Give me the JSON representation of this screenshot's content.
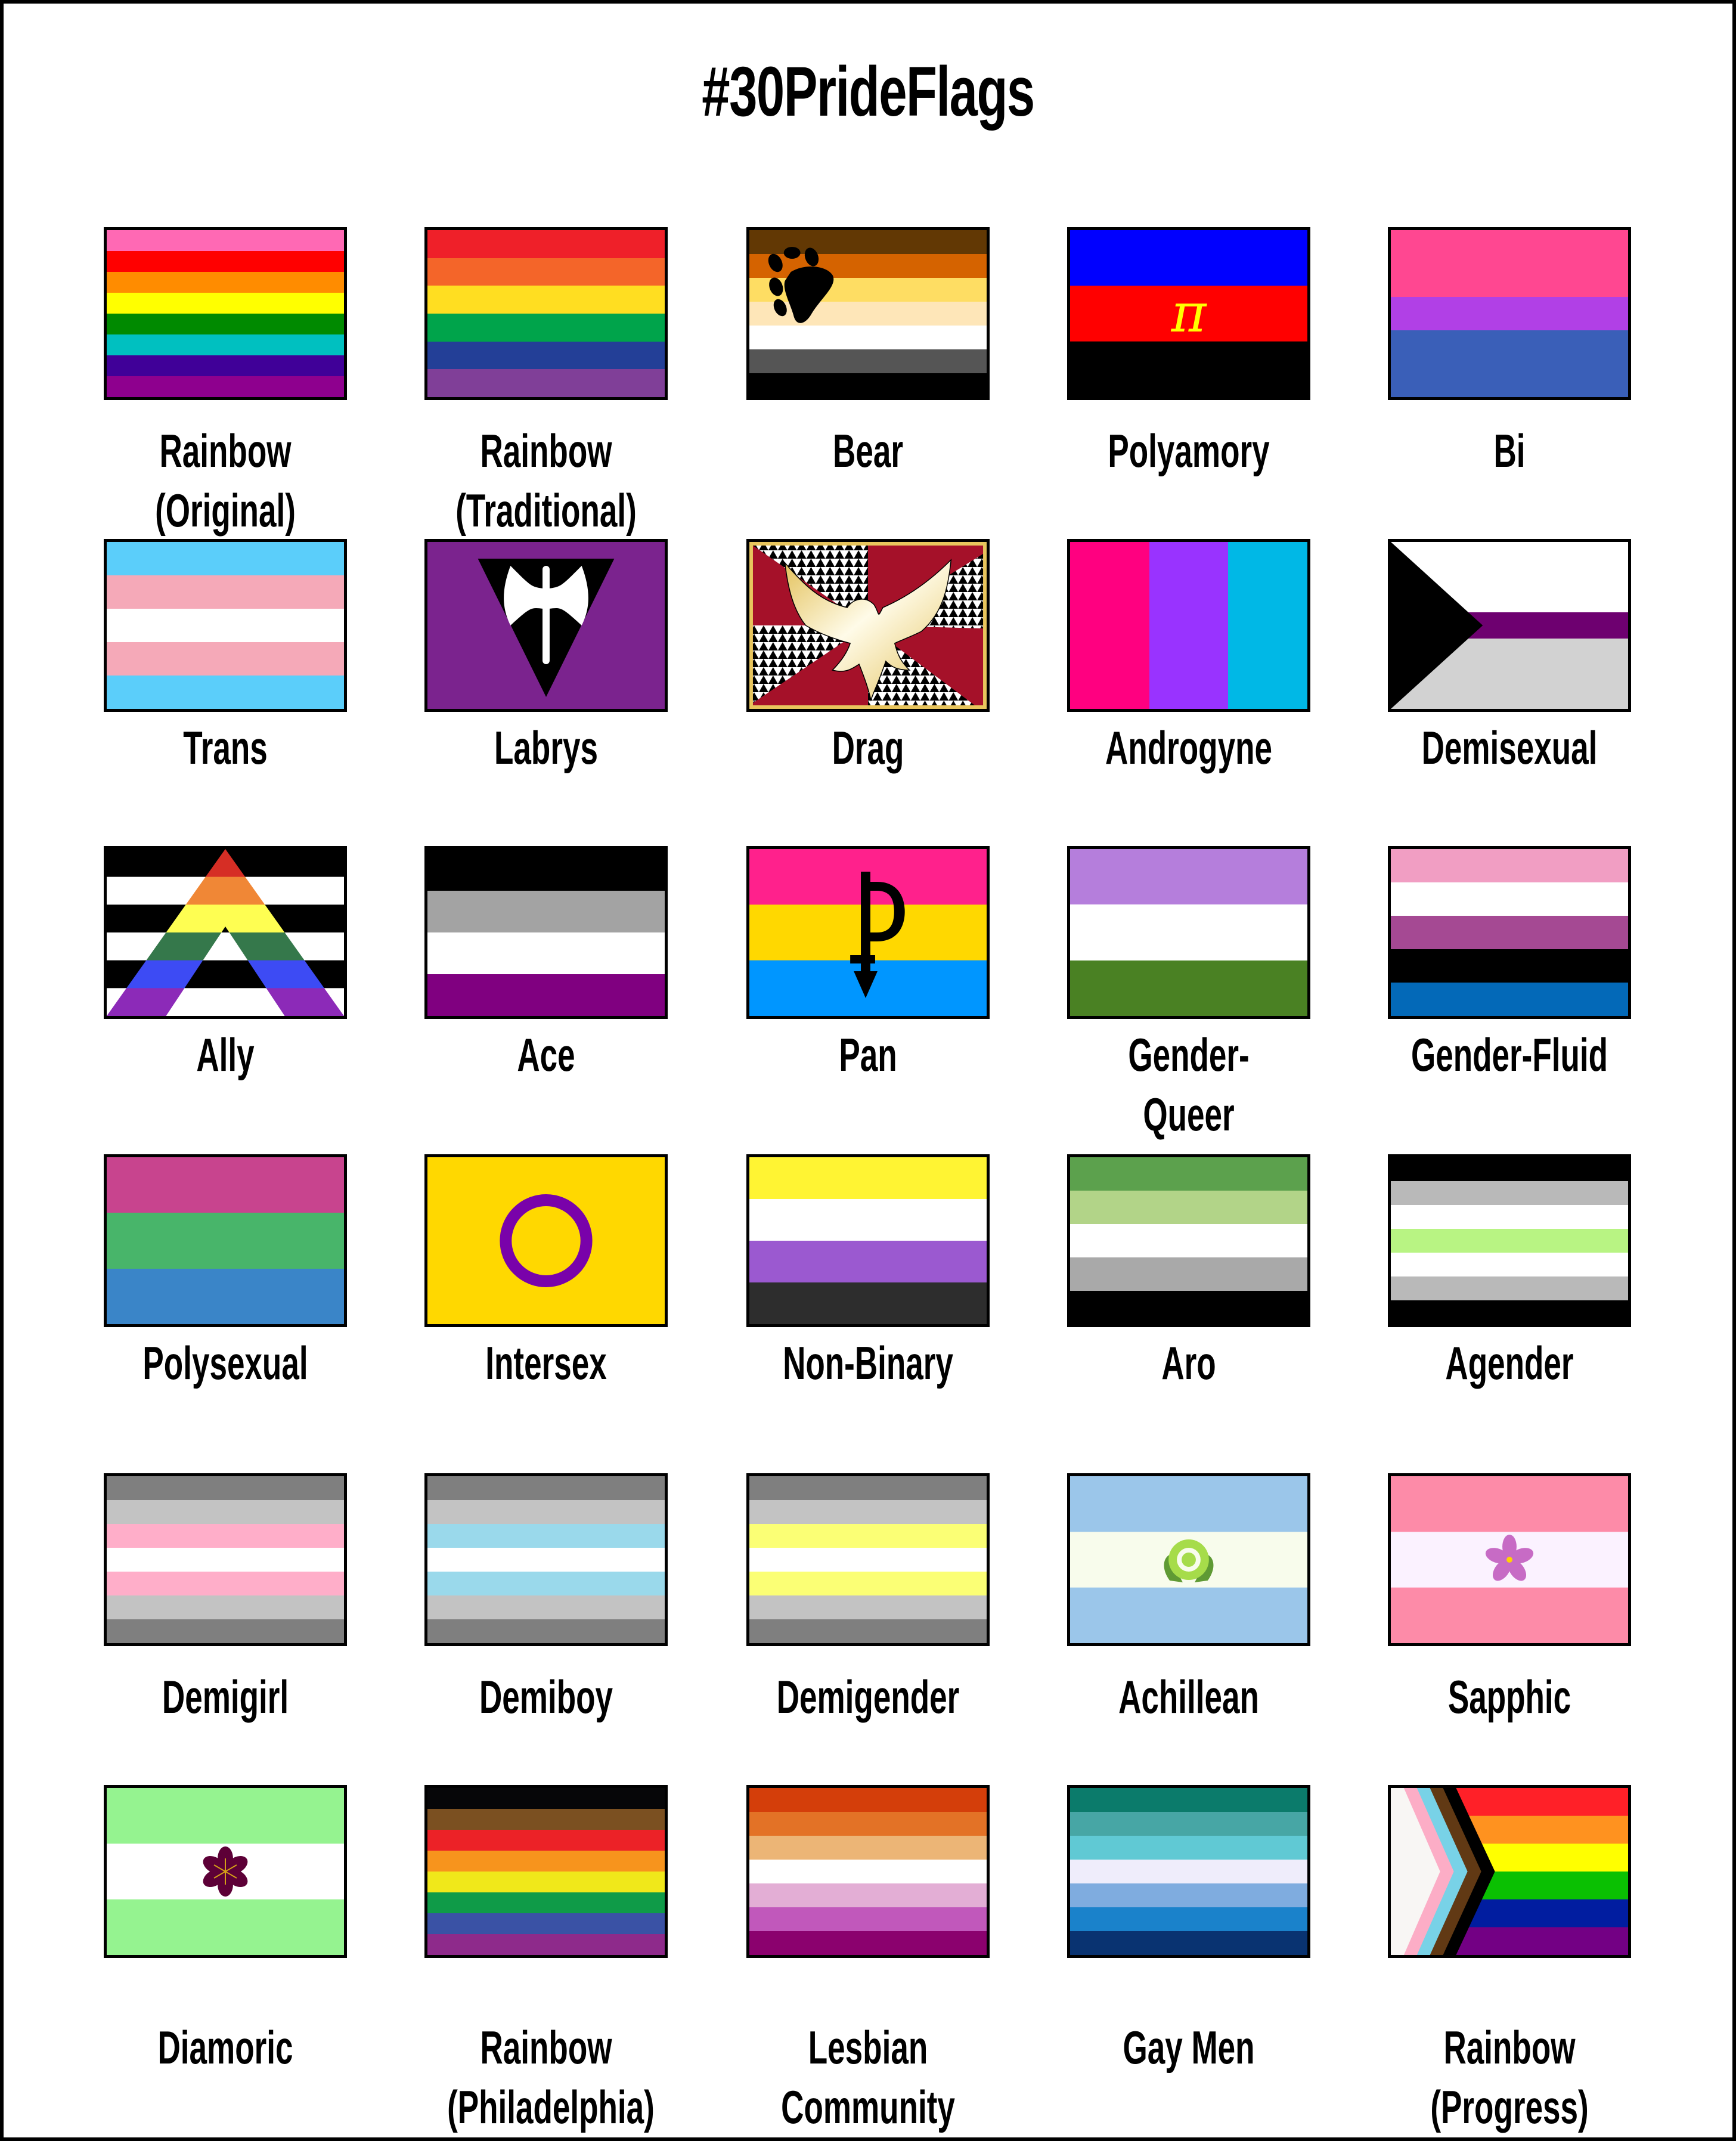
{
  "title": "#30PrideFlags",
  "flags": [
    {
      "name": "Rainbow",
      "subtitle": "(Original)",
      "colors": [
        "#ff69b4",
        "#ff0000",
        "#ff8c00",
        "#ffff00",
        "#008a00",
        "#00c0c0",
        "#400098",
        "#8e008e"
      ]
    },
    {
      "name": "Rainbow",
      "subtitle": "(Traditional)",
      "colors": [
        "#ef2029",
        "#f46529",
        "#ffde21",
        "#00a44b",
        "#233f97",
        "#803f98"
      ]
    },
    {
      "name": "Bear",
      "subtitle": "",
      "colors": [
        "#623804",
        "#d56300",
        "#fedd63",
        "#fee6b8",
        "#ffffff",
        "#555555",
        "#000000"
      ],
      "emblem": "paw-print"
    },
    {
      "name": "Polyamory",
      "subtitle": "",
      "colors": [
        "#0000ff",
        "#ff0000",
        "#000000"
      ],
      "emblem": "pi-symbol",
      "emblem_color": "#ffff00",
      "emblem_text": "π"
    },
    {
      "name": "Bi",
      "subtitle": "",
      "colors": [
        "#ff4791",
        "#ff4791",
        "#b140e6",
        "#3a5fb8",
        "#3a5fb8"
      ]
    },
    {
      "name": "Trans",
      "subtitle": "",
      "colors": [
        "#5bcefa",
        "#f5a9b8",
        "#ffffff",
        "#f5a9b8",
        "#5bcefa"
      ]
    },
    {
      "name": "Labrys",
      "subtitle": "",
      "colors": [
        "#7b238e"
      ],
      "emblem": "labrys-axe"
    },
    {
      "name": "Drag",
      "subtitle": "",
      "colors": [
        "#a51129",
        "#e8c55d"
      ],
      "emblem": "phoenix"
    },
    {
      "name": "Androgyne",
      "subtitle": "",
      "colors": [
        "#ff0080",
        "#9933ff",
        "#00b8e6"
      ],
      "orientation": "vertical"
    },
    {
      "name": "Demisexual",
      "subtitle": "",
      "colors": [
        "#ffffff",
        "#6e0070",
        "#d2d2d2",
        "#000000"
      ],
      "emblem": "chevron"
    },
    {
      "name": "Ally",
      "subtitle": "",
      "colors": [
        "#000000",
        "#ffffff",
        "#000000",
        "#ffffff",
        "#000000",
        "#ffffff"
      ],
      "triangle_colors": [
        "#d62e25",
        "#f08736",
        "#fefe52",
        "#35784b",
        "#3d4bf4",
        "#8c2ab8"
      ],
      "emblem": "lambda-triangle"
    },
    {
      "name": "Ace",
      "subtitle": "",
      "colors": [
        "#000000",
        "#a3a3a3",
        "#ffffff",
        "#800080"
      ]
    },
    {
      "name": "Pan",
      "subtitle": "",
      "colors": [
        "#ff218c",
        "#ffd800",
        "#0096ff"
      ],
      "emblem": "pan-symbol"
    },
    {
      "name": "Gender-Queer",
      "subtitle": "",
      "colors": [
        "#b57edc",
        "#ffffff",
        "#4a8123"
      ]
    },
    {
      "name": "Gender-Fluid",
      "subtitle": "",
      "colors": [
        "#f19ec3",
        "#ffffff",
        "#a54993",
        "#000000",
        "#0369b8"
      ]
    },
    {
      "name": "Polysexual",
      "subtitle": "",
      "colors": [
        "#c8448e",
        "#48b56a",
        "#3a85c8"
      ]
    },
    {
      "name": "Intersex",
      "subtitle": "",
      "colors": [
        "#ffd800"
      ],
      "emblem": "ring",
      "emblem_color": "#7902aa"
    },
    {
      "name": "Non-Binary",
      "subtitle": "",
      "colors": [
        "#fff433",
        "#ffffff",
        "#9b59d0",
        "#2d2d2d"
      ]
    },
    {
      "name": "Aro",
      "subtitle": "",
      "colors": [
        "#5ca14d",
        "#b2d488",
        "#ffffff",
        "#a9a9a9",
        "#000000"
      ]
    },
    {
      "name": "Agender",
      "subtitle": "",
      "colors": [
        "#000000",
        "#b9b9b9",
        "#ffffff",
        "#b8f483",
        "#ffffff",
        "#b9b9b9",
        "#000000"
      ]
    },
    {
      "name": "Demigirl",
      "subtitle": "",
      "colors": [
        "#7f7f7f",
        "#c3c3c3",
        "#ffaec9",
        "#ffffff",
        "#ffaec9",
        "#c3c3c3",
        "#7f7f7f"
      ]
    },
    {
      "name": "Demiboy",
      "subtitle": "",
      "colors": [
        "#7f7f7f",
        "#c3c3c3",
        "#9ad9eb",
        "#ffffff",
        "#9ad9eb",
        "#c3c3c3",
        "#7f7f7f"
      ]
    },
    {
      "name": "Demigender",
      "subtitle": "",
      "colors": [
        "#7f7f7f",
        "#c3c3c3",
        "#fbff75",
        "#ffffff",
        "#fbff75",
        "#c3c3c3",
        "#7f7f7f"
      ]
    },
    {
      "name": "Achillean",
      "subtitle": "",
      "colors": [
        "#9bc6ea",
        "#f8fcec",
        "#9bc6ea"
      ],
      "emblem": "carnation",
      "emblem_color": "#a6dc4a"
    },
    {
      "name": "Sapphic",
      "subtitle": "",
      "colors": [
        "#fd8ba8",
        "#fbf2ff",
        "#fd8ba8"
      ],
      "emblem": "violet-flower",
      "emblem_color": "#c76bc5"
    },
    {
      "name": "Diamoric",
      "subtitle": "",
      "colors": [
        "#95f390",
        "#ffffff",
        "#95f390"
      ],
      "emblem": "plum-blossom",
      "emblem_color": "#5d0037"
    },
    {
      "name": "Rainbow",
      "subtitle": "(Philadelphia)",
      "colors": [
        "#000000",
        "#784f17",
        "#e40303",
        "#ff8c00",
        "#ffed00",
        "#008026",
        "#004dff",
        "#750787"
      ],
      "display_colors": [
        "#060608",
        "#7b5021",
        "#ec2227",
        "#f7941d",
        "#f0e81a",
        "#0f9b48",
        "#3a52a5",
        "#8e2a8b"
      ]
    },
    {
      "name": "Lesbian",
      "subtitle": "Community",
      "colors": [
        "#d43e0a",
        "#e37226",
        "#ecb576",
        "#ffffff",
        "#e3aed5",
        "#c158bb",
        "#8b016e"
      ]
    },
    {
      "name": "Gay Men",
      "subtitle": "",
      "colors": [
        "#0b7b6b",
        "#47a6a5",
        "#60c9d4",
        "#efedfb",
        "#7facdf",
        "#1a82cb",
        "#093371"
      ]
    },
    {
      "name": "Rainbow",
      "subtitle": "(Progress)",
      "colors": [
        "#ff2028",
        "#ff921f",
        "#ffff00",
        "#0ac002",
        "#011da0",
        "#730084"
      ],
      "chevron_colors": [
        "#f8f6f4",
        "#fcadc6",
        "#78d2e7",
        "#613914",
        "#000000"
      ],
      "emblem": "progress-chevron"
    }
  ]
}
